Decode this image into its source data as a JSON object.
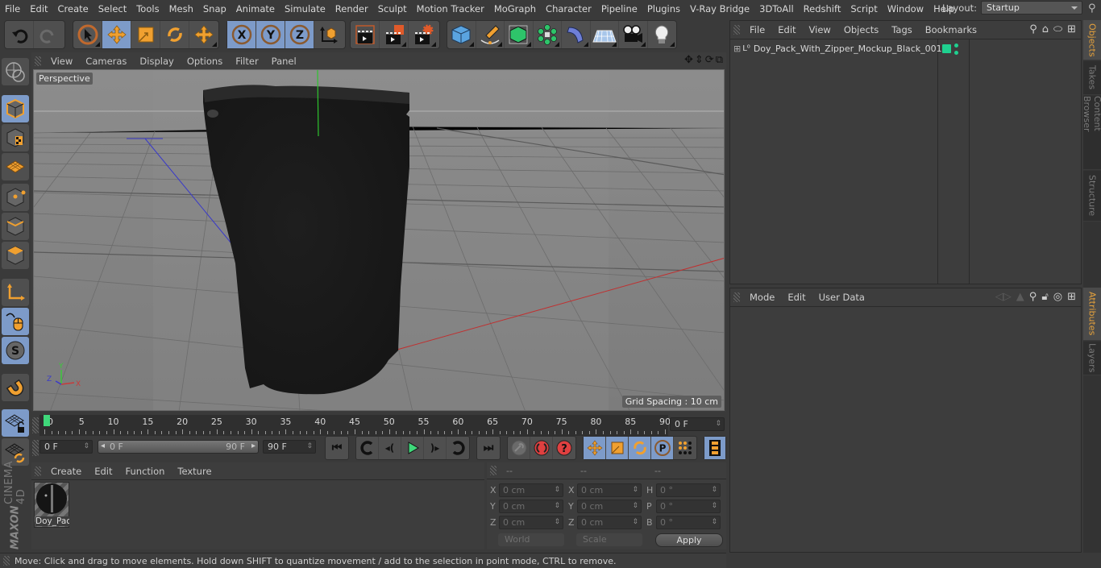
{
  "menubar": {
    "items": [
      "File",
      "Edit",
      "Create",
      "Select",
      "Tools",
      "Mesh",
      "Snap",
      "Animate",
      "Simulate",
      "Render",
      "Sculpt",
      "Motion Tracker",
      "MoGraph",
      "Character",
      "Pipeline",
      "Plugins",
      "V-Ray Bridge",
      "3DToAll",
      "Redshift",
      "Script",
      "Window",
      "Help"
    ],
    "layout_label": "Layout:",
    "layout_value": "Startup"
  },
  "toolbar": {
    "undo": "undo-icon",
    "redo": "redo-icon",
    "tools": [
      "live-selection",
      "move",
      "scale",
      "rotate",
      "recent-tool"
    ],
    "axes": [
      "X",
      "Y",
      "Z"
    ],
    "coord_system": "world-coordinates-icon",
    "render": [
      "render-view",
      "render-picture-viewer",
      "render-settings"
    ],
    "create": [
      "cube",
      "pen-spline",
      "subdivision-generator",
      "cloner",
      "deformer",
      "floor",
      "camera",
      "light"
    ]
  },
  "left_toolbar": {
    "items": [
      "make-editable",
      "model-mode",
      "texture-mode",
      "workplane-mode",
      "points-mode",
      "edges-mode",
      "polygons-mode",
      "axis-mode",
      "tweak-mode",
      "solo-mode",
      "snapping",
      "workplane-lock",
      "workplane-align"
    ]
  },
  "viewport": {
    "menu": [
      "View",
      "Cameras",
      "Display",
      "Options",
      "Filter",
      "Panel"
    ],
    "camera_label": "Perspective",
    "grid_spacing": "Grid Spacing : 10 cm",
    "axis_labels": {
      "x": "X",
      "y": "Y",
      "z": "Z"
    }
  },
  "timeline": {
    "ticks": [
      0,
      5,
      10,
      15,
      20,
      25,
      30,
      35,
      40,
      45,
      50,
      55,
      60,
      65,
      70,
      75,
      80,
      85,
      90
    ],
    "current_frame_field": "0 F",
    "start_field": "0 F",
    "range_start": "0 F",
    "range_end": "90 F",
    "end_field": "90 F",
    "current_frame": 0,
    "max_frame": 90
  },
  "material_manager": {
    "menu": [
      "Create",
      "Edit",
      "Function",
      "Texture"
    ],
    "materials": [
      {
        "name": "Doy_Pac"
      }
    ]
  },
  "coordinates": {
    "headers": [
      "--",
      "--",
      "--"
    ],
    "position": {
      "labels": [
        "X",
        "Y",
        "Z"
      ],
      "values": [
        "0 cm",
        "0 cm",
        "0 cm"
      ]
    },
    "size": {
      "labels": [
        "X",
        "Y",
        "Z"
      ],
      "values": [
        "0 cm",
        "0 cm",
        "0 cm"
      ]
    },
    "rotation": {
      "labels": [
        "H",
        "P",
        "B"
      ],
      "values": [
        "0 °",
        "0 °",
        "0 °"
      ]
    },
    "mode_select": "World",
    "type_select": "Scale",
    "apply_label": "Apply"
  },
  "objects_panel": {
    "menu": [
      "File",
      "Edit",
      "View",
      "Objects",
      "Tags",
      "Bookmarks"
    ],
    "objects": [
      {
        "name": "Doy_Pack_With_Zipper_Mockup_Black_001",
        "layer_color": "#1fd08f"
      }
    ]
  },
  "attributes_panel": {
    "menu": [
      "Mode",
      "Edit",
      "User Data"
    ]
  },
  "right_tabs": {
    "top": [
      {
        "label": "Objects",
        "active": true
      },
      {
        "label": "Takes",
        "active": false
      },
      {
        "label": "Content Browser",
        "active": false
      },
      {
        "label": "Structure",
        "active": false
      }
    ],
    "bottom": [
      {
        "label": "Attributes",
        "active": true
      },
      {
        "label": "Layers",
        "active": false
      }
    ]
  },
  "status_bar": {
    "text": "Move: Click and drag to move elements. Hold down SHIFT to quantize movement / add to the selection in point mode, CTRL to remove."
  },
  "branding": {
    "line1": "MAXON",
    "line2": "CINEMA 4D"
  },
  "colors": {
    "accent_blue": "#7d9bc9",
    "tool_orange": "#f0a030",
    "tab_active": "#e6a23c",
    "playhead": "#3fd87a"
  }
}
